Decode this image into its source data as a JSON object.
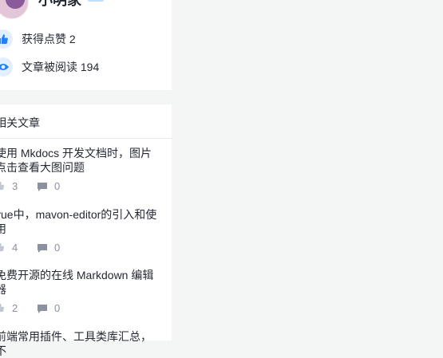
{
  "author": {
    "name": "小明家",
    "stats": {
      "likes_label": "获得点赞 2",
      "reads_label": "文章被阅读 194"
    }
  },
  "related": {
    "title": "相关文章",
    "articles": [
      {
        "title": "使用 Mkdocs 开发文档时，图片点击查看大图问题",
        "likes": "3",
        "comments": "0"
      },
      {
        "title": "vue中，mavon-editor的引入和使用",
        "likes": "4",
        "comments": "0"
      },
      {
        "title": "免费开源的在线 Markdown 编辑器",
        "likes": "2",
        "comments": "0"
      },
      {
        "title": "前端常用插件、工具类库汇总，不",
        "likes": "",
        "comments": ""
      }
    ]
  },
  "colors": {
    "page_bg": "#f4f5f5",
    "card_bg": "#ffffff",
    "accent": "#1e80ff",
    "muted": "#8a919f"
  },
  "icons": [
    "thumbs-up-icon",
    "eye-icon",
    "comment-icon"
  ]
}
